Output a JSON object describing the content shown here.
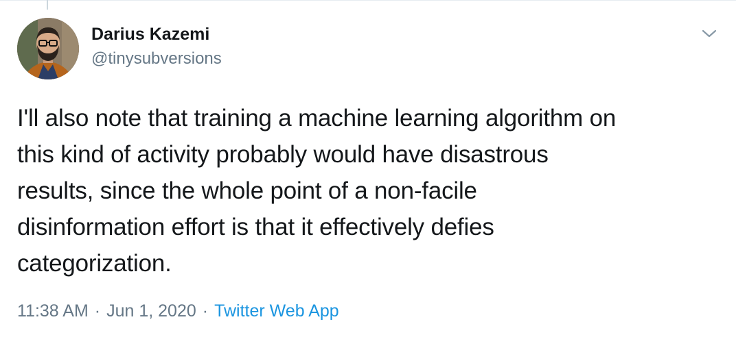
{
  "tweet": {
    "author": {
      "display_name": "Darius Kazemi",
      "handle": "@tinysubversions",
      "avatar_icon": "profile-photo"
    },
    "text": "I'll also note that training a machine learning algorithm on\nthis kind of activity probably would have disastrous\nresults, since the whole point of a non-facile\ndisinformation effort is that it effectively defies\ncategorization.",
    "time": "11:38 AM",
    "separator": "·",
    "date": "Jun 1, 2020",
    "source": "Twitter Web App",
    "menu_icon": "chevron-down-icon"
  },
  "colors": {
    "text_primary": "#14171a",
    "text_secondary": "#657786",
    "link": "#1b95e0",
    "border": "#e6ecf0"
  }
}
